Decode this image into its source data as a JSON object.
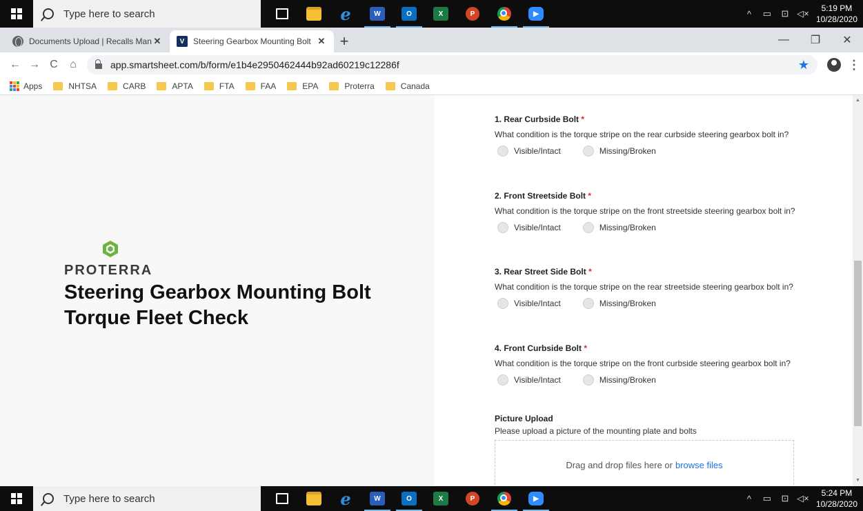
{
  "taskbar_top": {
    "search_placeholder": "Type here to search",
    "time": "5:19 PM",
    "date": "10/28/2020"
  },
  "taskbar_bottom": {
    "search_placeholder": "Type here to search",
    "time": "5:24 PM",
    "date": "10/28/2020"
  },
  "taskbar_apps": {
    "word": "W",
    "outlook": "O",
    "excel": "X",
    "ppt": "P",
    "ie": "e"
  },
  "tabs": [
    {
      "label": "Documents Upload | Recalls Man",
      "close": "✕"
    },
    {
      "label": "Steering Gearbox Mounting Bolt",
      "close": "✕",
      "favicon_letter": "V"
    }
  ],
  "window": {
    "minimize": "—",
    "restore": "❐",
    "close": "✕",
    "newtab": "+"
  },
  "address": {
    "url": "app.smartsheet.com/b/form/e1b4e2950462444b92ad60219c12286f"
  },
  "nav": {
    "back": "←",
    "forward": "→",
    "reload": "C",
    "home": "⌂",
    "star": "★",
    "menu": "⋮"
  },
  "bookmarks": {
    "apps_label": "Apps",
    "items": [
      "NHTSA",
      "CARB",
      "APTA",
      "FTA",
      "FAA",
      "EPA",
      "Proterra",
      "Canada"
    ]
  },
  "form": {
    "brand": "PROTERRA",
    "title": "Steering Gearbox Mounting Bolt Torque Fleet Check",
    "required_mark": "*",
    "questions": [
      {
        "title": "1. Rear Curbside Bolt",
        "desc": "What condition is the torque stripe on the rear curbside steering gearbox bolt in?",
        "options": [
          "Visible/Intact",
          "Missing/Broken"
        ]
      },
      {
        "title": "2. Front Streetside Bolt",
        "desc": "What condition is the torque stripe on the front streetside steering gearbox bolt in?",
        "options": [
          "Visible/Intact",
          "Missing/Broken"
        ]
      },
      {
        "title": "3. Rear Street Side Bolt",
        "desc": "What condition is the torque stripe on the rear streetside steering gearbox bolt in?",
        "options": [
          "Visible/Intact",
          "Missing/Broken"
        ]
      },
      {
        "title": "4. Front Curbside Bolt",
        "desc": "What condition is the torque stripe on the front curbside steering gearbox bolt in?",
        "options": [
          "Visible/Intact",
          "Missing/Broken"
        ]
      }
    ],
    "upload": {
      "title": "Picture Upload",
      "desc": "Please upload a picture of the mounting plate and bolts",
      "drop_text": "Drag and drop files here or",
      "browse_link": "browse files"
    }
  },
  "colors": {
    "accent": "#1a73e8",
    "brand_green": "#6cb33f",
    "required": "#d32f2f"
  }
}
